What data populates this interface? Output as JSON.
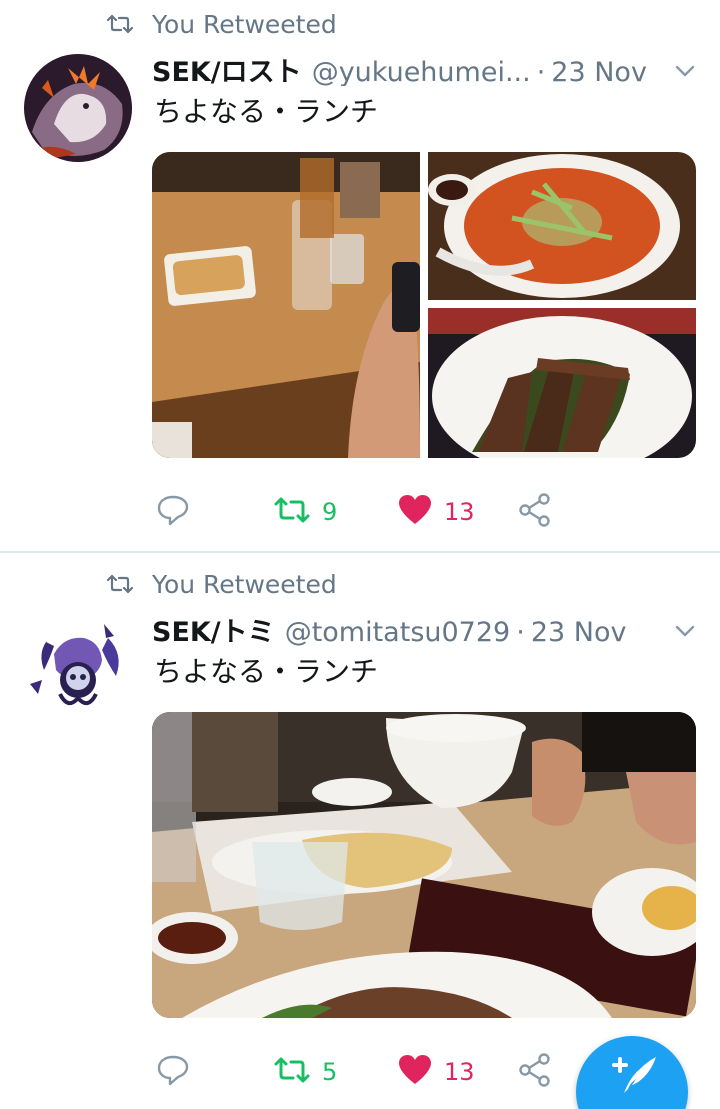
{
  "tweets": [
    {
      "retweet_label": "You Retweeted",
      "display_name": "SEK/ロスト",
      "handle": "@yukuehumei...",
      "separator": "·",
      "date": "23 Nov",
      "text": "ちよなる・ランチ",
      "media": [
        {
          "description": "gyoza-and-glasses-photo"
        },
        {
          "description": "red-noodle-soup-photo"
        },
        {
          "description": "grilled-ribs-plate-photo"
        }
      ],
      "actions": {
        "reply_icon": "reply-icon",
        "retweet_icon": "retweet-icon",
        "retweet_count": "9",
        "retweeted": true,
        "like_icon": "heart-icon",
        "like_count": "13",
        "liked": true,
        "share_icon": "share-icon"
      }
    },
    {
      "retweet_label": "You Retweeted",
      "display_name": "SEK/トミ",
      "handle": "@tomitatsu0729",
      "separator": "·",
      "date": "23 Nov",
      "text": "ちよなる・ランチ",
      "media": [
        {
          "description": "restaurant-table-photo"
        }
      ],
      "actions": {
        "reply_icon": "reply-icon",
        "retweet_icon": "retweet-icon",
        "retweet_count": "5",
        "retweeted": true,
        "like_icon": "heart-icon",
        "like_count": "13",
        "liked": true,
        "share_icon": "share-icon"
      }
    }
  ],
  "compose_button": {
    "icon": "compose-feather-icon"
  },
  "colors": {
    "retweet_green": "#17bf63",
    "like_pink": "#e0245e",
    "secondary_text": "#657786",
    "primary_text": "#14171a",
    "accent_blue": "#1da1f2",
    "divider": "#e1e8ed"
  }
}
